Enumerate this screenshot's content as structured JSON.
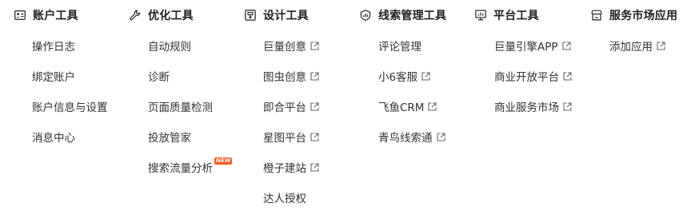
{
  "columns": [
    {
      "key": "account",
      "title": "账户工具",
      "icon": "id-card-icon",
      "items": [
        {
          "label": "操作日志",
          "external": false
        },
        {
          "label": "绑定账户",
          "external": false
        },
        {
          "label": "账户信息与设置",
          "external": false
        },
        {
          "label": "消息中心",
          "external": false
        }
      ]
    },
    {
      "key": "optimize",
      "title": "优化工具",
      "icon": "wrench-icon",
      "items": [
        {
          "label": "自动规则",
          "external": false
        },
        {
          "label": "诊断",
          "external": false
        },
        {
          "label": "页面质量检测",
          "external": false
        },
        {
          "label": "投放管家",
          "external": false
        },
        {
          "label": "搜索流量分析",
          "external": false,
          "badge": "NEW"
        }
      ]
    },
    {
      "key": "design",
      "title": "设计工具",
      "icon": "palette-box-icon",
      "items": [
        {
          "label": "巨量创意",
          "external": true
        },
        {
          "label": "图虫创意",
          "external": true
        },
        {
          "label": "即合平台",
          "external": true
        },
        {
          "label": "星图平台",
          "external": true
        },
        {
          "label": "橙子建站",
          "external": true
        },
        {
          "label": "达人授权",
          "external": false
        }
      ]
    },
    {
      "key": "leads",
      "title": "线索管理工具",
      "icon": "shield-chart-icon",
      "items": [
        {
          "label": "评论管理",
          "external": false
        },
        {
          "label": "小6客服",
          "external": true
        },
        {
          "label": "飞鱼CRM",
          "external": true
        },
        {
          "label": "青鸟线索通",
          "external": true
        }
      ]
    },
    {
      "key": "platform",
      "title": "平台工具",
      "icon": "monitor-chart-icon",
      "items": [
        {
          "label": "巨量引擎APP",
          "external": true
        },
        {
          "label": "商业开放平台",
          "external": true
        },
        {
          "label": "商业服务市场",
          "external": true
        }
      ]
    },
    {
      "key": "market",
      "title": "服务市场应用",
      "icon": "storefront-icon",
      "items": [
        {
          "label": "添加应用",
          "external": true
        }
      ]
    }
  ]
}
